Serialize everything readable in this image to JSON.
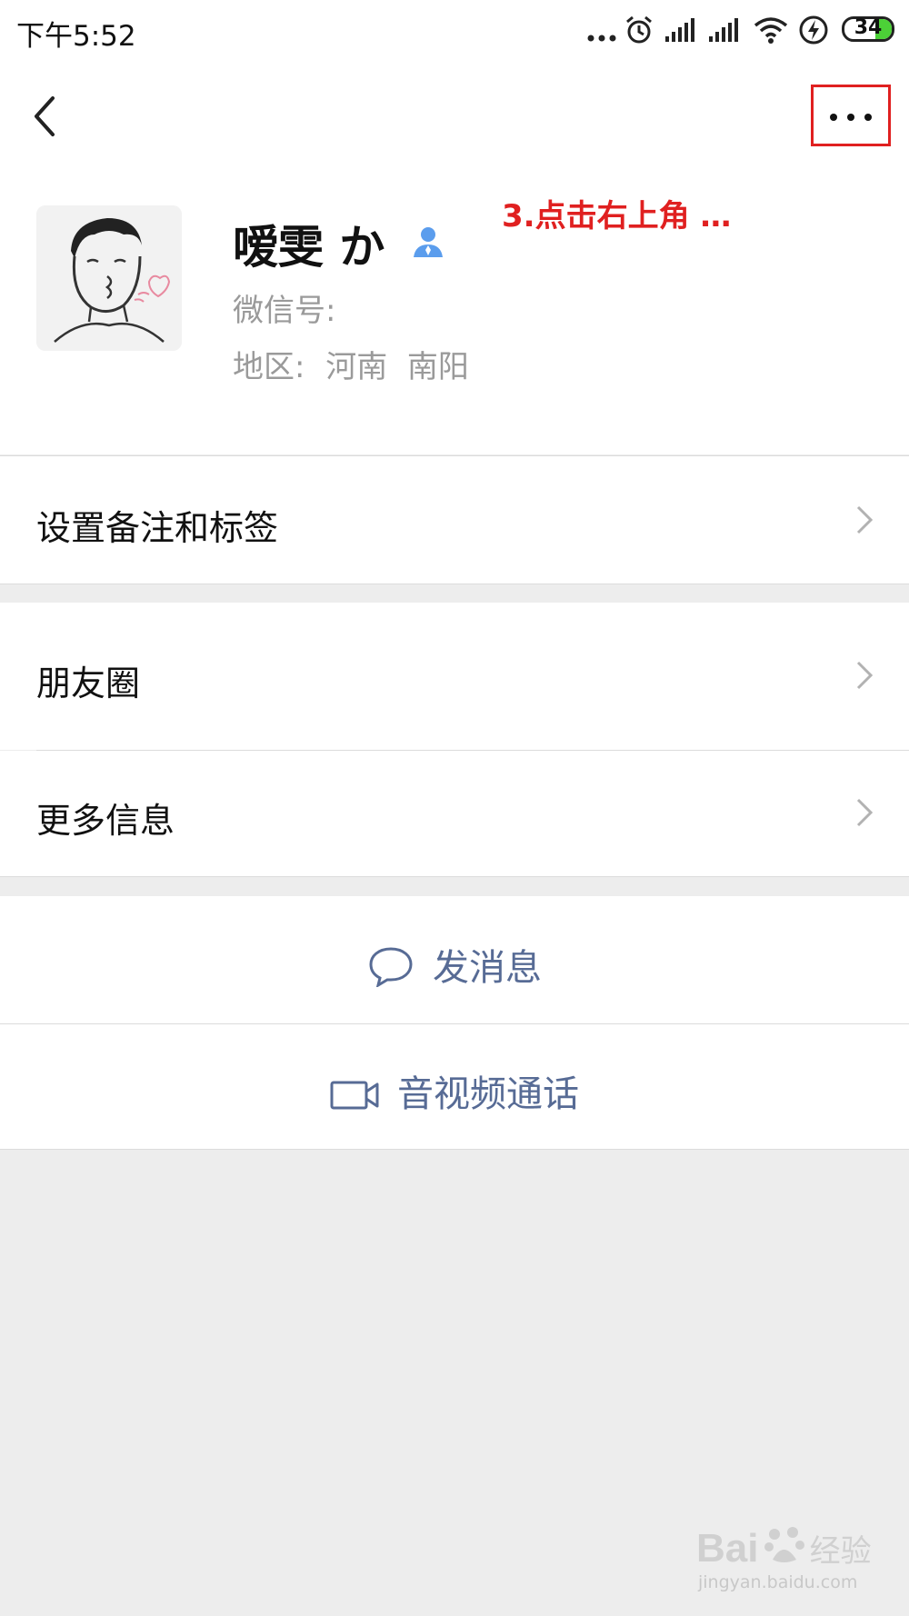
{
  "status_bar": {
    "time": "下午5:52",
    "battery": "34",
    "battery_level_percent": 34,
    "icons": [
      "more-dots-icon",
      "alarm-icon",
      "signal-icon",
      "signal-icon",
      "wifi-icon",
      "charging-icon",
      "battery-icon"
    ]
  },
  "nav": {
    "back_icon": "chevron-left-icon",
    "more_icon": "more-horizontal-icon"
  },
  "annotation": "3.点击右上角 …",
  "profile": {
    "name": "嗳雯 か",
    "wechat_id_label": "微信号:",
    "region_label": "地区:",
    "region_value": "河南  南阳",
    "badge_icon": "contact-person-icon"
  },
  "rows": [
    {
      "label": "设置备注和标签"
    },
    {
      "label": "朋友圈"
    },
    {
      "label": "更多信息"
    }
  ],
  "actions": [
    {
      "label": "发消息",
      "icon": "chat-bubble-icon"
    },
    {
      "label": "音视频通话",
      "icon": "video-camera-icon"
    }
  ],
  "watermark": {
    "brand": "Bai",
    "brand_suffix": "经验",
    "sub": "jingyan.baidu.com"
  },
  "colors": {
    "accent_link": "#576b95",
    "annotation_red": "#e02020",
    "background": "#ededed",
    "battery_green": "#4cd137"
  }
}
